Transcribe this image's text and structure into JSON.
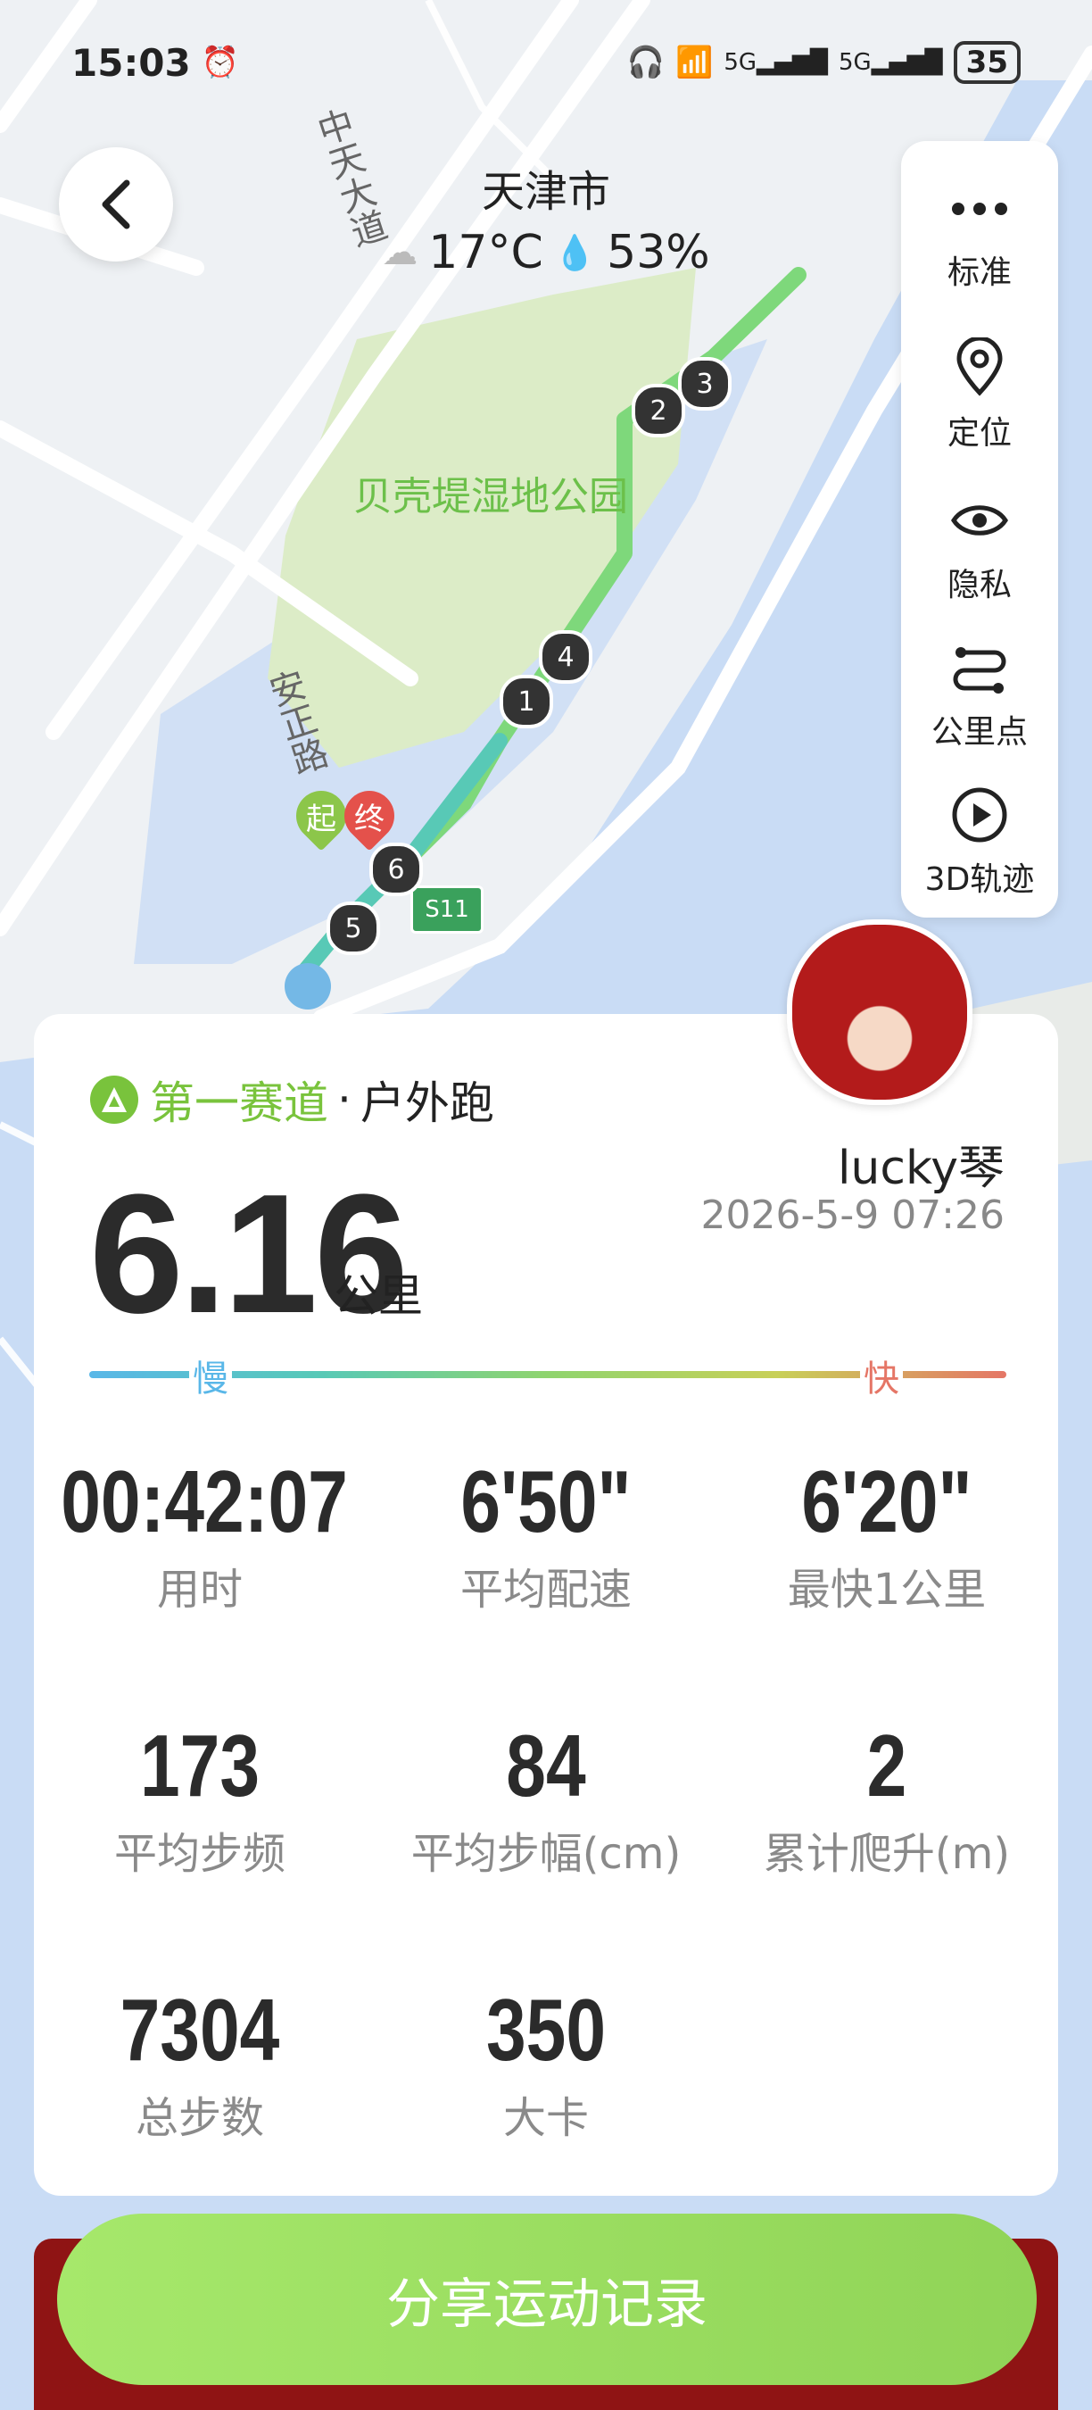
{
  "status_bar": {
    "time": "15:03",
    "battery": "35"
  },
  "map": {
    "city": "天津市",
    "temperature": "17°C",
    "humidity": "53%",
    "road_labels": [
      "中天大道",
      "安正路",
      "S11"
    ],
    "park_label": "贝壳堤湿地公园",
    "km_markers": [
      "1",
      "2",
      "3",
      "4",
      "5",
      "6"
    ],
    "start_label": "起",
    "end_label": "终"
  },
  "side_panel": {
    "items": [
      {
        "label": "标准",
        "icon": "more-icon"
      },
      {
        "label": "定位",
        "icon": "location-icon"
      },
      {
        "label": "隐私",
        "icon": "eye-icon"
      },
      {
        "label": "公里点",
        "icon": "route-icon"
      },
      {
        "label": "3D轨迹",
        "icon": "play-icon"
      }
    ]
  },
  "record": {
    "brand": "第一赛道",
    "separator": "·",
    "sport": "户外跑",
    "distance": "6.16",
    "unit": "公里",
    "user": "lucky琴",
    "date": "2026-5-9 07:26",
    "slow_label": "慢",
    "fast_label": "快",
    "metrics": [
      {
        "value": "00:42:07",
        "label": "用时"
      },
      {
        "value": "6'50\"",
        "label": "平均配速"
      },
      {
        "value": "6'20\"",
        "label": "最快1公里"
      },
      {
        "value": "173",
        "label": "平均步频"
      },
      {
        "value": "84",
        "label": "平均步幅(cm)"
      },
      {
        "value": "2",
        "label": "累计爬升(m)"
      },
      {
        "value": "7304",
        "label": "总步数"
      },
      {
        "value": "350",
        "label": "大卡"
      }
    ]
  },
  "share_button": "分享运动记录",
  "colors": {
    "accent": "#79c33c",
    "route": "#7ed87b",
    "water": "#c9dcf5",
    "park": "#dcecc7"
  }
}
